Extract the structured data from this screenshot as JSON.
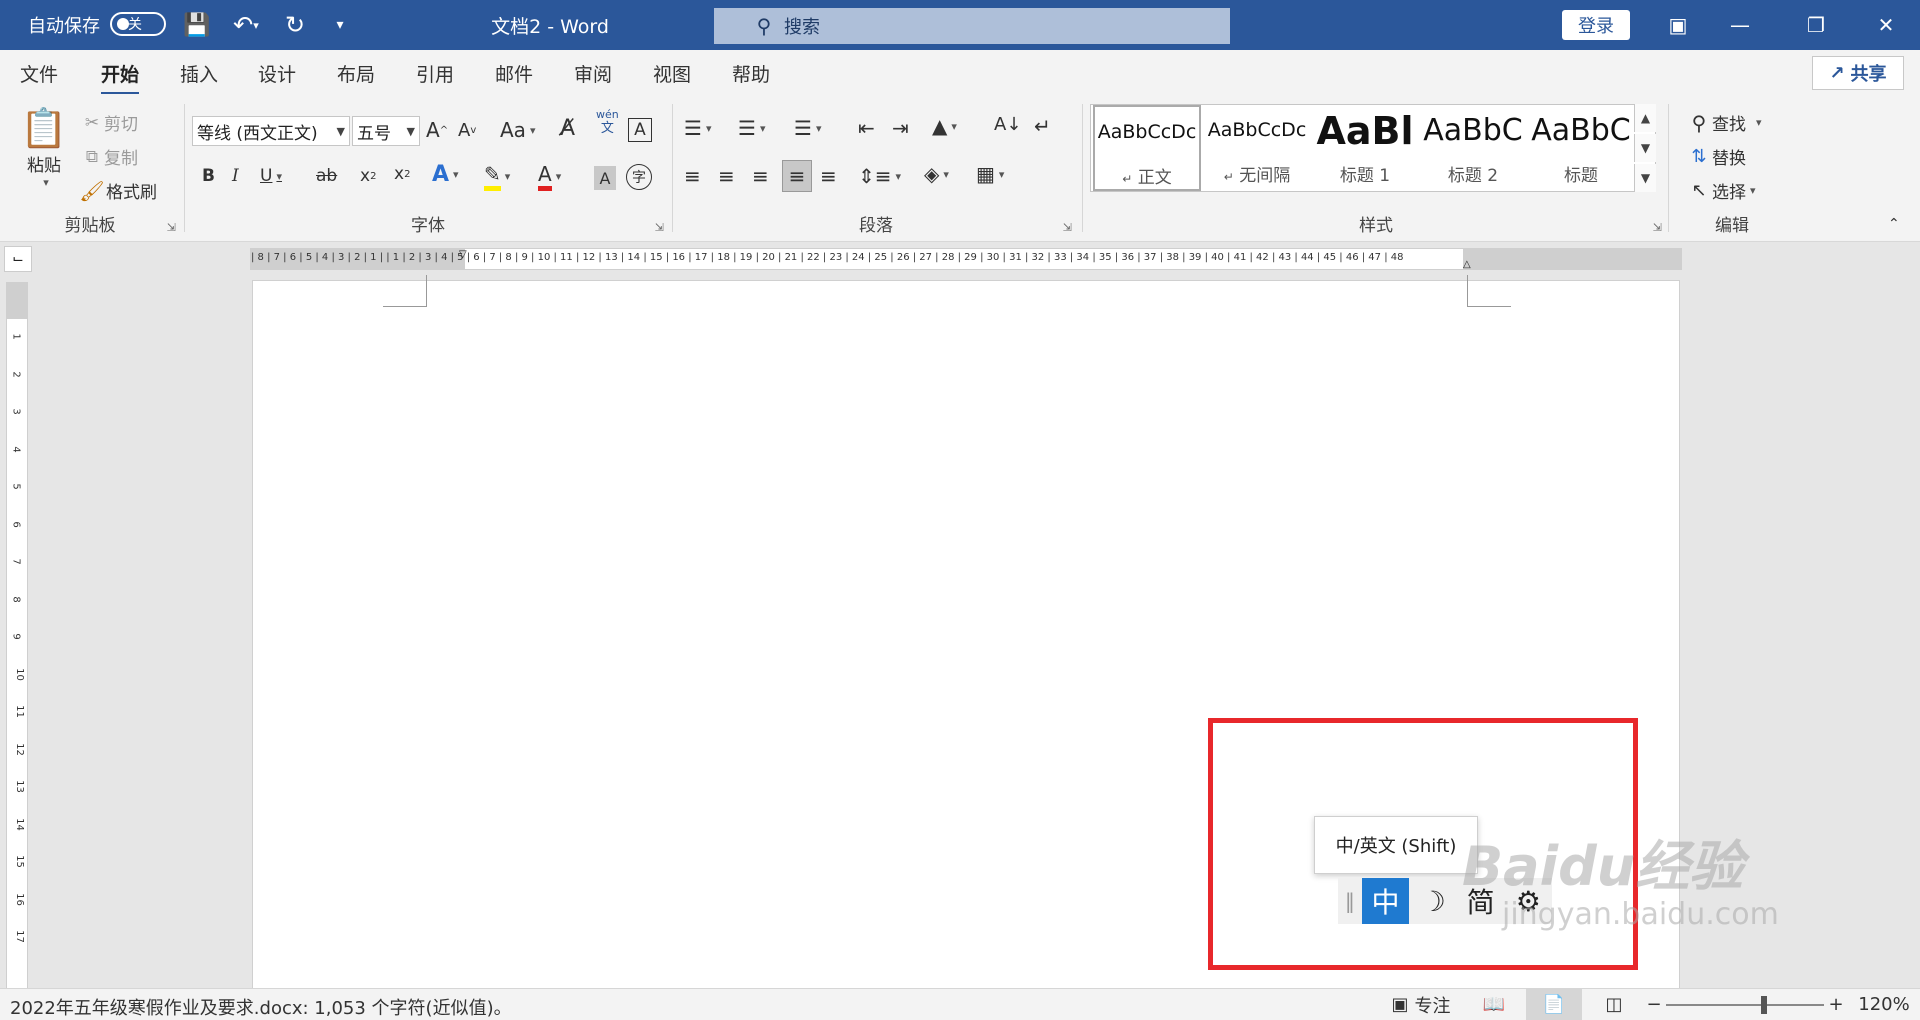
{
  "titlebar": {
    "autosave_label": "自动保存",
    "autosave_state": "关",
    "doc_title": "文档2  -  Word",
    "search_placeholder": "搜索",
    "login": "登录",
    "accent": "#2b579a"
  },
  "tabs": [
    "文件",
    "开始",
    "插入",
    "设计",
    "布局",
    "引用",
    "邮件",
    "审阅",
    "视图",
    "帮助"
  ],
  "active_tab": "开始",
  "share": "共享",
  "clipboard": {
    "paste": "粘贴",
    "cut": "剪切",
    "copy": "复制",
    "format_painter": "格式刷",
    "group": "剪贴板"
  },
  "font": {
    "family": "等线 (西文正文)",
    "size": "五号",
    "group": "字体",
    "change_case": "Aa",
    "pinyin": "wén",
    "pinyin_char": "文"
  },
  "paragraph": {
    "group": "段落"
  },
  "styles": {
    "group": "样式",
    "items": [
      {
        "sample": "AaBbCcDc",
        "name": "正文",
        "mark": "↵"
      },
      {
        "sample": "AaBbCcDc",
        "name": "无间隔",
        "mark": "↵"
      },
      {
        "sample": "AaBl",
        "name": "标题 1"
      },
      {
        "sample": "AaBbC",
        "name": "标题 2"
      },
      {
        "sample": "AaBbC",
        "name": "标题"
      }
    ]
  },
  "editing": {
    "find": "查找",
    "replace": "替换",
    "select": "选择",
    "group": "编辑"
  },
  "ruler": {
    "horizontal": "| 8 | 7 | 6 | 5 | 4 | 3 | 2 | 1 |    | 1 | 2 | 3 | 4 | 5 | 6 | 7 | 8 | 9 | 10 | 11 | 12 | 13 | 14 | 15 | 16 | 17 | 18 | 19 | 20 | 21 | 22 | 23 | 24 | 25 | 26 | 27 | 28 | 29 | 30 | 31 | 32 | 33 | 34 | 35 | 36 | 37 | 38 | 39 | 40 | 41 | 42 | 43 | 44 | 45 | 46 | 47 | 48",
    "vertical": [
      "1",
      "2",
      "3",
      "4",
      "5",
      "6",
      "7",
      "8",
      "9",
      "10",
      "11",
      "12",
      "13",
      "14",
      "15",
      "16",
      "17"
    ]
  },
  "ime": {
    "tooltip": "中/英文 (Shift)",
    "mode": "中",
    "moon": "☽",
    "simplified": "简",
    "gear": "⚙"
  },
  "watermark": {
    "brand": "Baidu经验",
    "url": "jingyan.baidu.com"
  },
  "status": {
    "text": "2022年五年级寒假作业及要求.docx: 1,053 个字符(近似值)。",
    "focus": "专注",
    "zoom": "120%",
    "zoom_fraction": 0.62,
    "minus": "−",
    "plus": "+"
  },
  "colors": {
    "highlight_box": "#e8282b",
    "ime_active": "#1f7ad0"
  }
}
